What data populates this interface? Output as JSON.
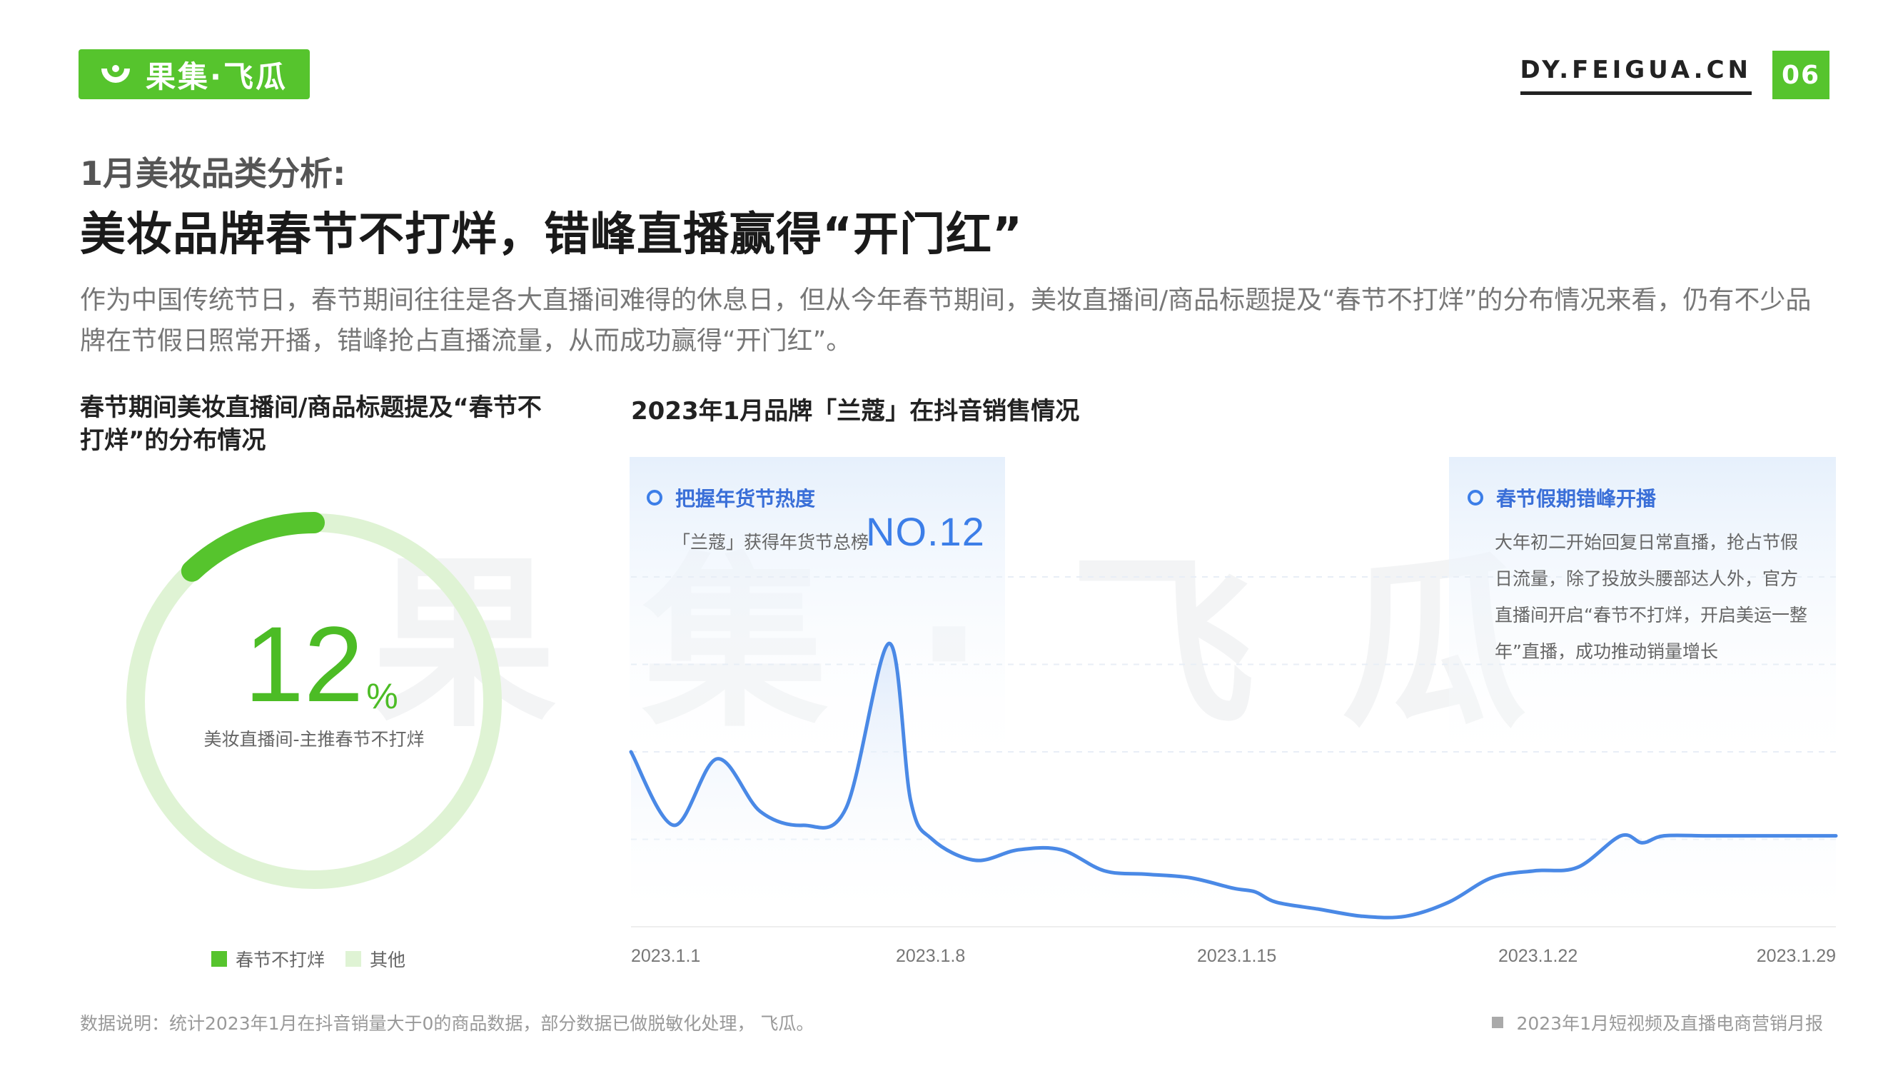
{
  "header": {
    "logo_text": "果集·飞瓜",
    "site": "DY.FEIGUA.CN",
    "page_number": "06"
  },
  "colors": {
    "green": "#56c42d",
    "green_light": "#dff3d4",
    "blue": "#4a89e6"
  },
  "title": {
    "sub": "1月美妆品类分析:",
    "main": "美妆品牌春节不打烊，错峰直播赢得“开门红”"
  },
  "intro": "作为中国传统节日，春节期间往往是各大直播间难得的休息日，但从今年春节期间，美妆直播间/商品标题提及“春节不打烊”的分布情况来看，仍有不少品牌在节假日照常开播，错峰抢占直播流量，从而成功赢得“开门红”。",
  "left_panel": {
    "heading": "春节期间美妆直播间/商品标题提及“春节不打烊”的分布情况",
    "percent_value": "12",
    "percent_sign": "%",
    "caption": "美妆直播间-主推春节不打烊",
    "legend": [
      "春节不打烊",
      "其他"
    ]
  },
  "right_panel": {
    "heading": "2023年1月品牌「兰蔻」在抖音销售情况",
    "annotation1": {
      "title": "把握年货节热度",
      "text": "「兰蔻」获得年货节总榜",
      "highlight": "NO.12"
    },
    "annotation2": {
      "title": "春节假期错峰开播",
      "text": "大年初二开始回复日常直播，抢占节假日流量，除了投放头腰部达人外，官方直播间开启“春节不打烊，开启美运一整年”直播，成功推动销量增长"
    }
  },
  "chart_data": [
    {
      "type": "pie",
      "title": "",
      "slices": [
        {
          "name": "春节不打烊",
          "value": 12,
          "color": "#56c42d"
        },
        {
          "name": "其他",
          "value": 88,
          "color": "#dff3d4"
        }
      ]
    },
    {
      "type": "line",
      "title": "2023年1月品牌「兰蔻」在抖音销售情况",
      "xlabel": "",
      "ylabel": "",
      "y_axis_shown": false,
      "x_ticks": [
        "2023.1.1",
        "2023.1.8",
        "2023.1.15",
        "2023.1.22",
        "2023.1.29"
      ],
      "xlim": [
        1,
        29
      ],
      "ylim": [
        0,
        100
      ],
      "grid": "horizontal dashed",
      "series": [
        {
          "x": [
            1,
            2,
            3,
            4,
            5,
            6,
            7,
            7.5,
            8,
            9,
            10,
            11,
            12,
            13,
            14,
            15,
            15.5,
            16,
            17,
            18,
            19,
            20,
            21,
            22,
            23,
            24,
            24.5,
            25,
            26,
            27,
            28,
            29
          ],
          "y": [
            50,
            29,
            48,
            33,
            29,
            34,
            81,
            36,
            25,
            19,
            22,
            22,
            16,
            15,
            14,
            11,
            10,
            7,
            5,
            3,
            3,
            7,
            14,
            16,
            17,
            26,
            24,
            26,
            26,
            26,
            26,
            26
          ]
        }
      ]
    }
  ]
}
